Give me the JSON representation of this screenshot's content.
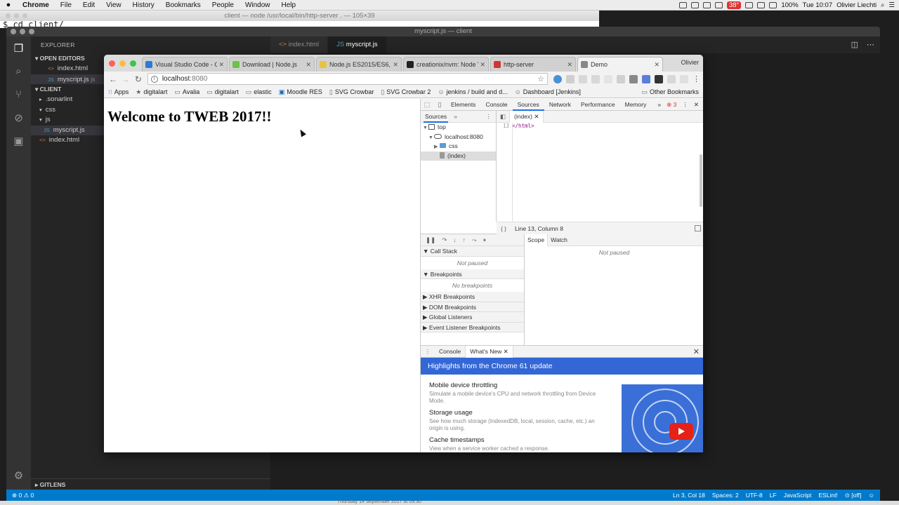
{
  "menubar": {
    "app": "Chrome",
    "items": [
      "File",
      "Edit",
      "View",
      "History",
      "Bookmarks",
      "People",
      "Window",
      "Help"
    ],
    "temperature": "38°",
    "battery": "100%",
    "clock": "Tue 10:07",
    "user": "Olivier Liechti"
  },
  "terminal": {
    "title": "client — node /usr/local/bin/http-server . — 105×39",
    "line": "$ cd client/"
  },
  "vscode": {
    "title": "myscript.js — client",
    "explorer_title": "EXPLORER",
    "open_editors_label": "OPEN EDITORS",
    "open_editors": [
      {
        "name": "index.html",
        "type": "html"
      },
      {
        "name": "myscript.js",
        "type": "js",
        "suffix": "js"
      }
    ],
    "folder_label": "CLIENT",
    "tree": [
      {
        "name": ".sonarlint",
        "kind": "folder",
        "open": false
      },
      {
        "name": "css",
        "kind": "folder",
        "open": true
      },
      {
        "name": "js",
        "kind": "folder",
        "open": true
      },
      {
        "name": "myscript.js",
        "kind": "js"
      },
      {
        "name": "index.html",
        "kind": "html"
      }
    ],
    "footer_section": "GITLENS",
    "tabs": [
      {
        "label": "index.html",
        "active": false
      },
      {
        "label": "myscript.js",
        "active": true
      }
    ],
    "status_left": "⊗ 0 ⚠ 0",
    "status_right": [
      "Ln 3, Col 18",
      "Spaces: 2",
      "UTF-8",
      "LF",
      "JavaScript",
      "ESLint!",
      "⊙ [off]",
      "☺"
    ]
  },
  "chrome": {
    "tabs": [
      {
        "title": "Visual Studio Code - C",
        "color": "#2c7ad6"
      },
      {
        "title": "Download | Node.js",
        "color": "#6cc24a"
      },
      {
        "title": "Node.js ES2015/ES6,",
        "color": "#e8c340"
      },
      {
        "title": "creationix/nvm: Node V",
        "color": "#222222"
      },
      {
        "title": "http-server",
        "color": "#cb3837"
      },
      {
        "title": "Demo",
        "color": "#888888"
      }
    ],
    "profile": "Olivier",
    "url_host": "localhost",
    "url_port": ":8080",
    "bookmarks": [
      "Apps",
      "digitalart",
      "Avalia",
      "digitalart",
      "elastic",
      "Moodle RES",
      "SVG Crowbar",
      "SVG Crowbar 2",
      "jenkins / build and d...",
      "Dashboard [Jenkins]"
    ],
    "other_bookmarks": "Other Bookmarks"
  },
  "page": {
    "heading": "Welcome to TWEB 2017!!"
  },
  "devtools": {
    "tabs": [
      "Elements",
      "Console",
      "Sources",
      "Network",
      "Performance",
      "Memory"
    ],
    "active_tab": "Sources",
    "error_count": "3",
    "navigator_tab": "Sources",
    "tree": {
      "top": "top",
      "host": "localhost:8080",
      "folder": "css",
      "file": "(index)"
    },
    "file_tab": "(index)",
    "code_line_number": "13",
    "code_line": "</html>",
    "cursor_position": "Line 13, Column 8",
    "call_stack_label": "Call Stack",
    "not_paused": "Not paused",
    "breakpoints_label": "Breakpoints",
    "no_breakpoints": "No breakpoints",
    "collapsed_panes": [
      "XHR Breakpoints",
      "DOM Breakpoints",
      "Global Listeners",
      "Event Listener Breakpoints"
    ],
    "scope_tab": "Scope",
    "watch_tab": "Watch",
    "scope_not_paused": "Not paused",
    "drawer_tabs": [
      "Console",
      "What's New"
    ],
    "whats_new_banner": "Highlights from the Chrome 61 update",
    "whats_new_items": [
      {
        "title": "Mobile device throttling",
        "desc": "Simulate a mobile device's CPU and network throttling from Device Mode."
      },
      {
        "title": "Storage usage",
        "desc": "See how much storage (IndexedDB, local, session, cache, etc.) an origin is using."
      },
      {
        "title": "Cache timestamps",
        "desc": "View when a service worker cached a response."
      }
    ]
  },
  "background": {
    "note": "Thursday 14 September 2017 at 09:30"
  }
}
